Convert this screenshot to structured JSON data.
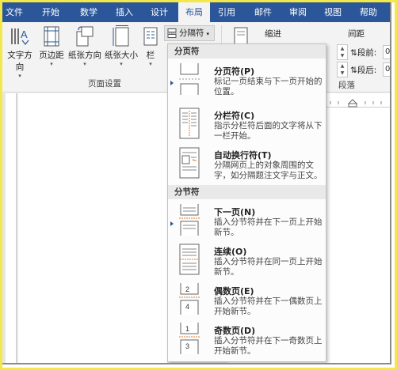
{
  "tabs": [
    "文件",
    "开始",
    "数学",
    "插入",
    "设计",
    "布局",
    "引用",
    "邮件",
    "审阅",
    "视图",
    "帮助"
  ],
  "active_tab": "布局",
  "ribbon": {
    "text_direction": "文字方向",
    "margins": "页边距",
    "orientation": "纸张方向",
    "size": "纸张大小",
    "columns": "栏",
    "group_page_setup": "页面设置",
    "breaks": "分隔符",
    "indent_label": "缩进",
    "spacing_label": "间距",
    "before_label": "段前:",
    "before_value": "0",
    "after_label": "段后:",
    "after_value": "0",
    "group_paragraph": "段落"
  },
  "breaks_menu": {
    "section_page": "分页符",
    "section_section": "分节符",
    "items": [
      {
        "title": "分页符(P)",
        "desc": "标记一页结束与下一页开始的位置。"
      },
      {
        "title": "分栏符(C)",
        "desc": "指示分栏符后面的文字将从下一栏开始。"
      },
      {
        "title": "自动换行符(T)",
        "desc": "分隔网页上的对象周围的文字，如分隔题注文字与正文。"
      },
      {
        "title": "下一页(N)",
        "desc": "插入分节符并在下一页上开始新节。"
      },
      {
        "title": "连续(O)",
        "desc": "插入分节符并在同一页上开始新节。"
      },
      {
        "title": "偶数页(E)",
        "desc": "插入分节符并在下一偶数页上开始新节。"
      },
      {
        "title": "奇数页(D)",
        "desc": "插入分节符并在下一奇数页上开始新节。"
      }
    ]
  },
  "icons": {
    "page_break": "page-break-icon",
    "column_break": "column-break-icon",
    "text_wrap": "text-wrapping-break-icon",
    "next_page": "next-page-section-icon",
    "continuous": "continuous-section-icon",
    "even_page": "even-page-section-icon",
    "odd_page": "odd-page-section-icon"
  },
  "colors": {
    "ribbon_blue": "#2b579a",
    "highlight_border": "#f3e84a",
    "accent_orange": "#e07a2e"
  }
}
